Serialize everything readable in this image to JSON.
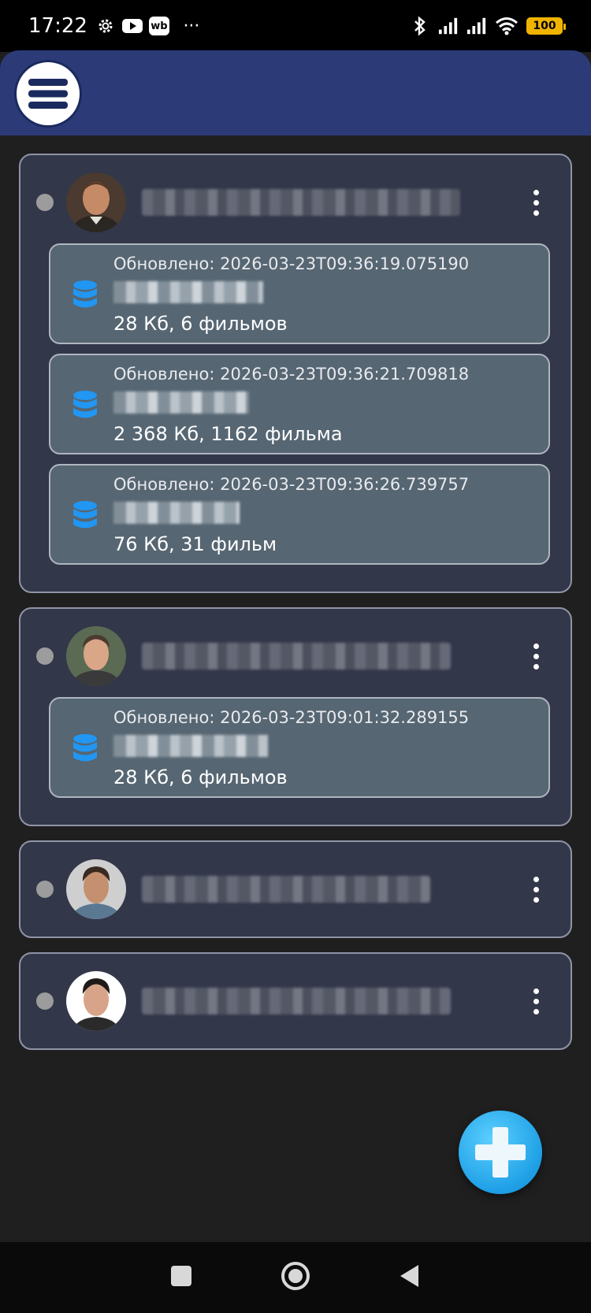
{
  "status_bar": {
    "time": "17:22",
    "left_icons": [
      "gear-icon",
      "youtube-icon",
      "wb-icon",
      "more-dots-icon"
    ],
    "wb_label": "wb",
    "dots": "···",
    "right_icons": [
      "bluetooth-icon",
      "signal-icon",
      "signal-icon",
      "wifi-icon",
      "battery-icon"
    ],
    "battery": "100"
  },
  "app_bar": {
    "menu_icon": "menu-icon"
  },
  "accounts": [
    {
      "avatar": "avatar-man-1",
      "databases": [
        {
          "updated": "Обновлено: 2026-03-23T09:36:19.075190",
          "size": "28 Кб, 6 фильмов"
        },
        {
          "updated": "Обновлено: 2026-03-23T09:36:21.709818",
          "size": "2 368 Кб, 1162 фильма"
        },
        {
          "updated": "Обновлено: 2026-03-23T09:36:26.739757",
          "size": "76 Кб, 31 фильм"
        }
      ]
    },
    {
      "avatar": "avatar-man-2",
      "databases": [
        {
          "updated": "Обновлено: 2026-03-23T09:01:32.289155",
          "size": "28 Кб, 6 фильмов"
        }
      ]
    },
    {
      "avatar": "avatar-man-3",
      "databases": []
    },
    {
      "avatar": "avatar-man-4",
      "databases": []
    }
  ],
  "fab": {
    "icon": "plus-icon"
  },
  "nav_bar": {
    "icons": [
      "recents-icon",
      "home-icon",
      "back-icon"
    ]
  },
  "colors": {
    "app_bar": "#2c3b78",
    "card": "#323749",
    "db_item": "#566672",
    "db_icon": "#2196f3",
    "fab": "#1e9fe6",
    "battery": "#f0b400"
  }
}
